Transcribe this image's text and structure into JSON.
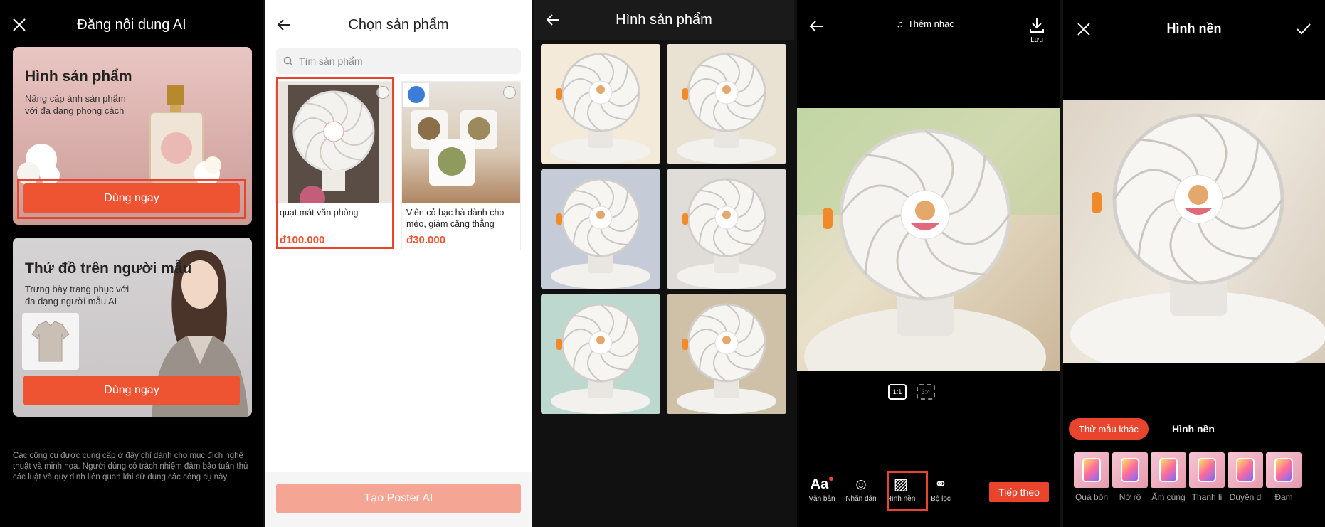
{
  "screen1": {
    "title": "Đăng nội dung AI",
    "card1": {
      "title": "Hình sản phẩm",
      "subtitle": "Nâng cấp ảnh sản phẩm với đa dạng phong cách",
      "button": "Dùng ngay"
    },
    "card2": {
      "title": "Thử đồ trên người mẫu",
      "subtitle": "Trưng bày trang phục với đa dạng người mẫu AI",
      "button": "Dùng ngay"
    },
    "disclaimer": "Các công cụ được cung cấp ở đây chỉ dành cho mục đích nghệ thuật và minh họa. Người dùng có trách nhiệm đảm bảo tuân thủ các luật và quy định liên quan khi sử dụng các công cụ này."
  },
  "screen2": {
    "title": "Chọn sản phẩm",
    "search_placeholder": "Tìm sản phẩm",
    "products": [
      {
        "name": "quạt mát văn phòng",
        "price": "đ100.000"
      },
      {
        "name": "Viên cỏ bạc hà dành cho mèo, giảm căng thẳng",
        "price": "đ30.000"
      }
    ],
    "button": "Tạo Poster AI"
  },
  "screen3": {
    "title": "Hình sản phẩm"
  },
  "screen4": {
    "music": "Thêm nhạc",
    "save": "Lưu",
    "ratios": [
      "1:1",
      "3:4"
    ],
    "tools": [
      {
        "icon": "text-icon",
        "glyph": "Aa",
        "label": "Văn bản"
      },
      {
        "icon": "sticker-icon",
        "glyph": "☺",
        "label": "Nhãn dán"
      },
      {
        "icon": "background-icon",
        "glyph": "▨",
        "label": "Hình nền"
      },
      {
        "icon": "filter-icon",
        "glyph": "⚭",
        "label": "Bộ lọc"
      }
    ],
    "next": "Tiếp theo"
  },
  "screen5": {
    "title": "Hình nền",
    "tab_active": "Thử mẫu khác",
    "tab_other": "Hình nền",
    "backgrounds": [
      "Quả bón",
      "Nở rộ",
      "Ấm cúng",
      "Thanh lị",
      "Duyên d",
      "Đam"
    ]
  },
  "colors": {
    "accent": "#ee5431",
    "highlight": "#e8442e"
  }
}
